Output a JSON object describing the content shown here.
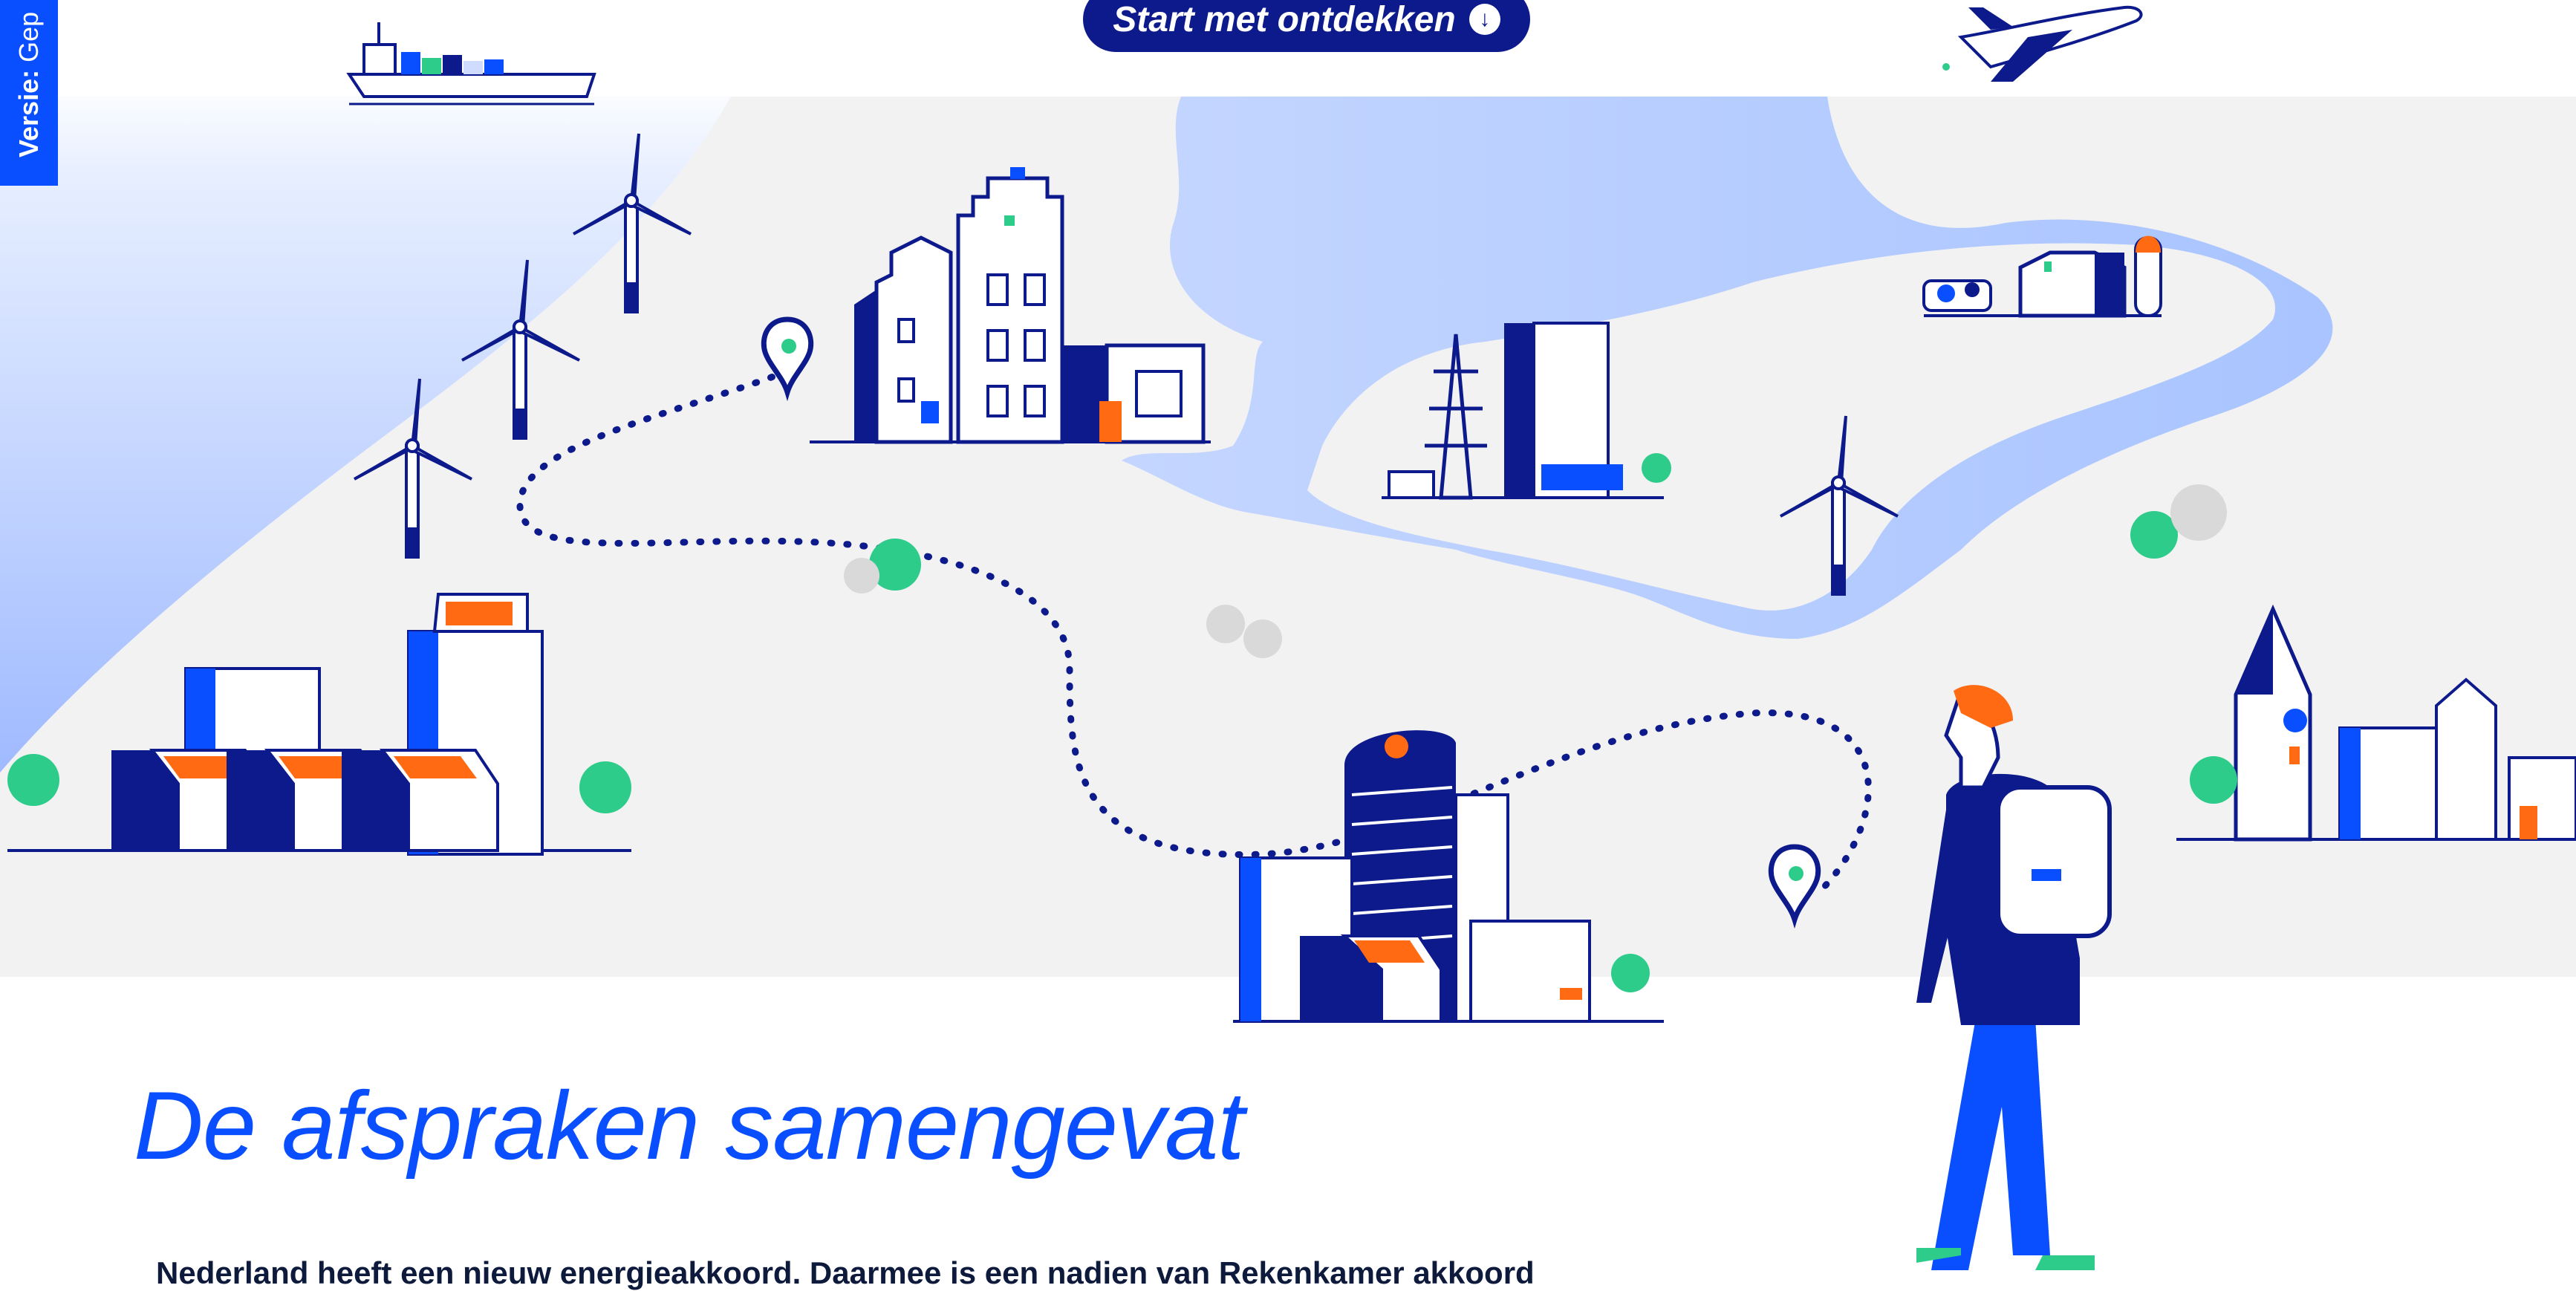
{
  "version_tab": {
    "label": "Versie:",
    "value": "Gep"
  },
  "cta": {
    "label": "Start met ontdekken",
    "icon": "arrow-down-circle-icon"
  },
  "heading": "De afspraken samengevat",
  "intro_text": "Nederland heeft een nieuw energieakkoord. Daarmee is een nadien van Rekenkamer akkoord",
  "colors": {
    "brand_blue": "#0a4fff",
    "dark_navy": "#0d1a8c",
    "accent_orange": "#ff6a13",
    "accent_green": "#2ecc8a",
    "water_blue": "#a9c4ff",
    "land_grey": "#f2f2f2"
  }
}
